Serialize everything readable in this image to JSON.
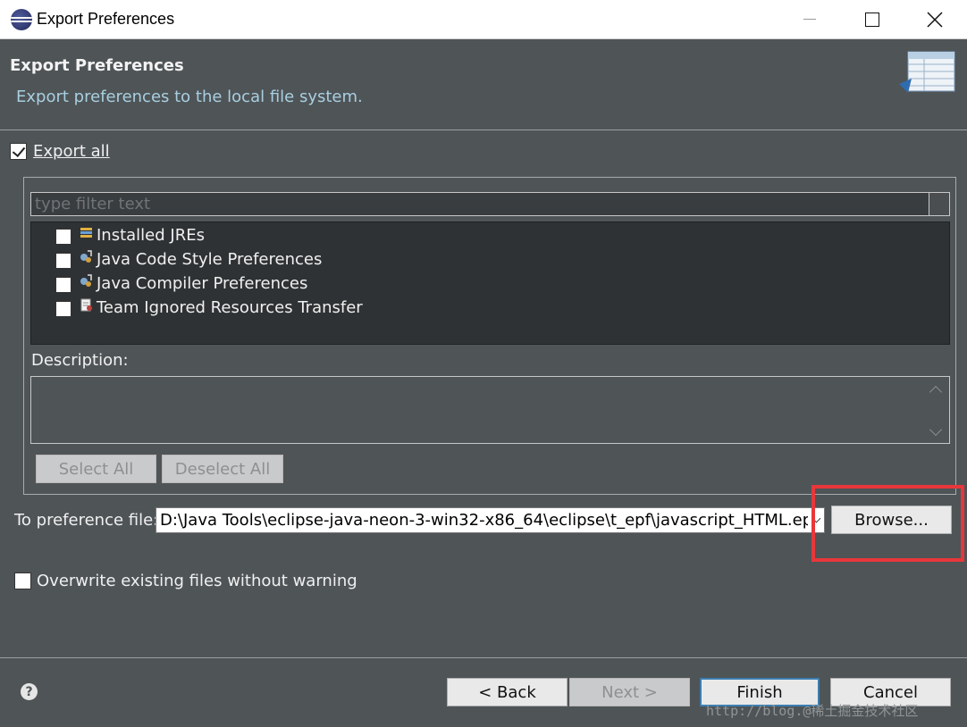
{
  "window": {
    "title": "Export Preferences"
  },
  "header": {
    "title": "Export Preferences",
    "subtitle": "Export preferences to the local file system."
  },
  "export_all": {
    "label": "Export all",
    "checked": true
  },
  "filter": {
    "placeholder": "type filter text"
  },
  "tree_items": [
    {
      "label": "Installed JREs",
      "icon": "jre-icon",
      "checked": false
    },
    {
      "label": "Java Code Style Preferences",
      "icon": "java-prefs-icon",
      "checked": false
    },
    {
      "label": "Java Compiler Preferences",
      "icon": "java-prefs-icon",
      "checked": false
    },
    {
      "label": "Team Ignored Resources Transfer",
      "icon": "team-icon",
      "checked": false
    }
  ],
  "description": {
    "label": "Description:",
    "text": ""
  },
  "selection_buttons": {
    "select_all": "Select All",
    "deselect_all": "Deselect All"
  },
  "preference_file": {
    "label": "To preference file:",
    "value": "D:\\Java Tools\\eclipse-java-neon-3-win32-x86_64\\eclipse\\t_epf\\javascript_HTML.epf",
    "browse": "Browse..."
  },
  "overwrite": {
    "label": "Overwrite existing files without warning",
    "checked": false
  },
  "footer": {
    "back": "< Back",
    "next": "Next >",
    "finish": "Finish",
    "cancel": "Cancel"
  },
  "watermark": "http://blog.@稀土掘金技术社区",
  "colors": {
    "background": "#4f5457",
    "highlight": "#e8373a",
    "subtitle": "#a8cfe0",
    "default_button_border": "#3c7fb1"
  }
}
